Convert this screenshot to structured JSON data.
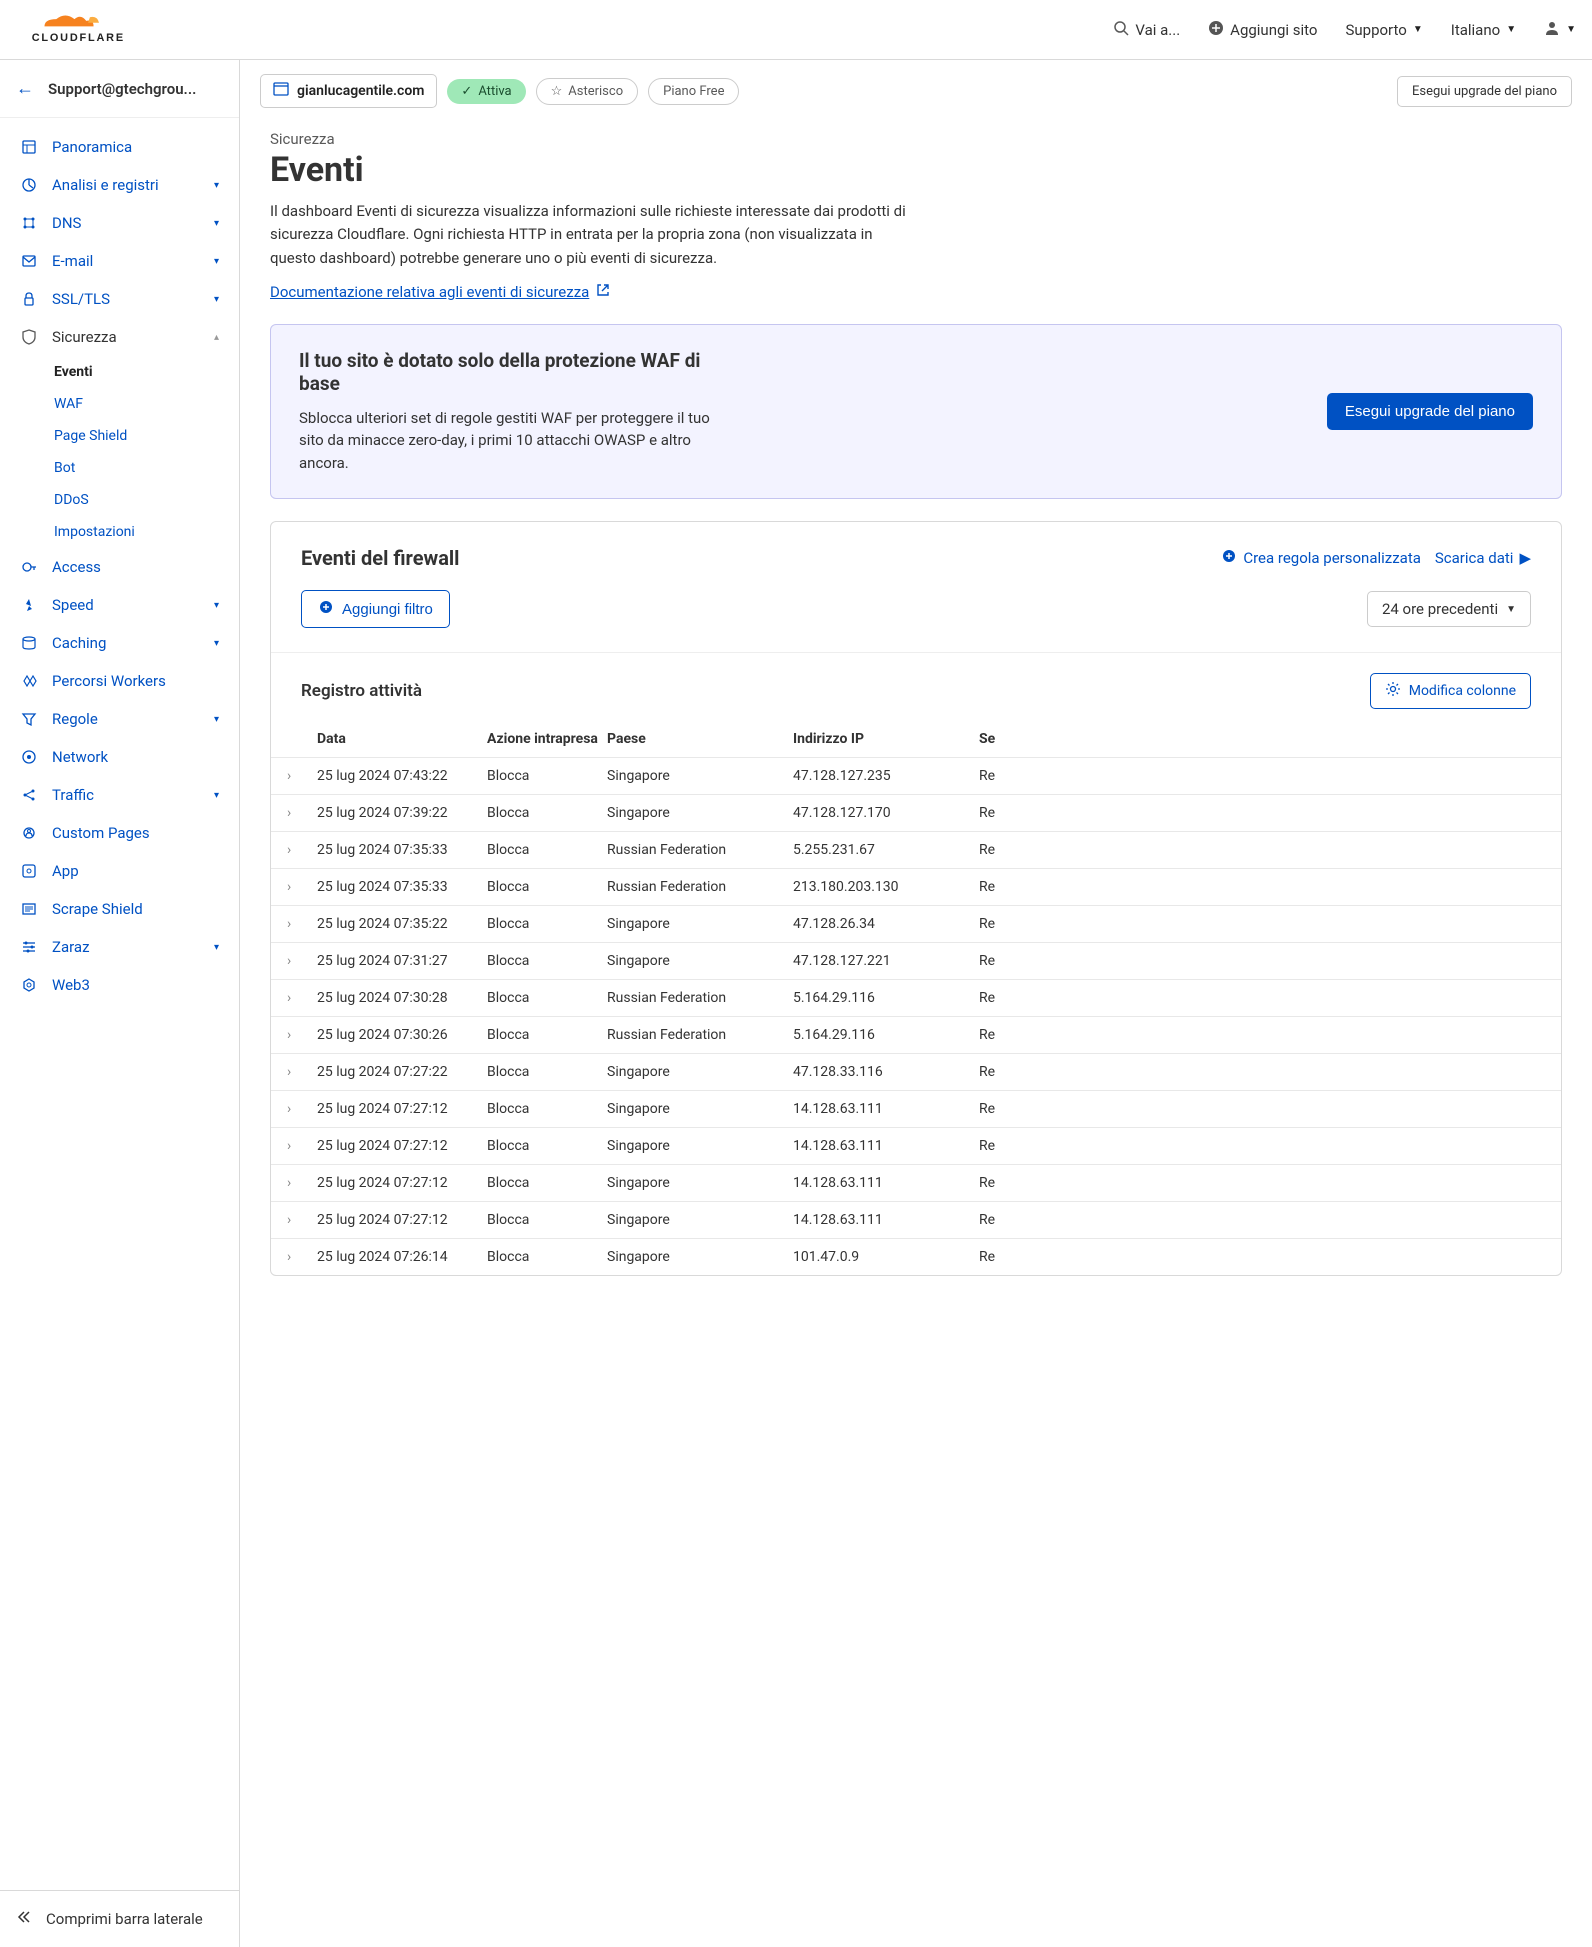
{
  "header": {
    "visit": "Vai a...",
    "add_site": "Aggiungi sito",
    "support": "Supporto",
    "language": "Italiano"
  },
  "account": {
    "email": "Support@gtechgrou..."
  },
  "sidebar": {
    "items": [
      {
        "label": "Panoramica",
        "key": "overview"
      },
      {
        "label": "Analisi e registri",
        "key": "analytics",
        "chev": true
      },
      {
        "label": "DNS",
        "key": "dns",
        "chev": true
      },
      {
        "label": "E-mail",
        "key": "email",
        "chev": true
      },
      {
        "label": "SSL/TLS",
        "key": "ssl",
        "chev": true
      },
      {
        "label": "Sicurezza",
        "key": "security",
        "chev": true,
        "expanded": true
      },
      {
        "label": "Access",
        "key": "access"
      },
      {
        "label": "Speed",
        "key": "speed",
        "chev": true
      },
      {
        "label": "Caching",
        "key": "caching",
        "chev": true
      },
      {
        "label": "Percorsi Workers",
        "key": "workers"
      },
      {
        "label": "Regole",
        "key": "rules",
        "chev": true
      },
      {
        "label": "Network",
        "key": "network"
      },
      {
        "label": "Traffic",
        "key": "traffic",
        "chev": true
      },
      {
        "label": "Custom Pages",
        "key": "cpages"
      },
      {
        "label": "App",
        "key": "app"
      },
      {
        "label": "Scrape Shield",
        "key": "scrape"
      },
      {
        "label": "Zaraz",
        "key": "zaraz",
        "chev": true
      },
      {
        "label": "Web3",
        "key": "web3"
      }
    ],
    "security_sub": [
      {
        "label": "Eventi",
        "active": true
      },
      {
        "label": "WAF"
      },
      {
        "label": "Page Shield"
      },
      {
        "label": "Bot"
      },
      {
        "label": "DDoS"
      },
      {
        "label": "Impostazioni"
      }
    ],
    "collapse": "Comprimi barra laterale"
  },
  "domain": {
    "name": "gianlucagentile.com",
    "active": "Attiva",
    "asterisk": "Asterisco",
    "plan": "Piano Free",
    "upgrade": "Esegui upgrade del piano"
  },
  "page": {
    "breadcrumb": "Sicurezza",
    "title": "Eventi",
    "description": "Il dashboard Eventi di sicurezza visualizza informazioni sulle richieste interessate dai prodotti di sicurezza Cloudflare. Ogni richiesta HTTP in entrata per la propria zona (non visualizzata in questo dashboard) potrebbe generare uno o più eventi di sicurezza.",
    "doc_link": "Documentazione relativa agli eventi di sicurezza"
  },
  "banner": {
    "title": "Il tuo sito è dotato solo della protezione WAF di base",
    "text": "Sblocca ulteriori set di regole gestiti WAF per proteggere il tuo sito da minacce zero-day, i primi 10 attacchi OWASP e altro ancora.",
    "button": "Esegui upgrade del piano"
  },
  "firewall": {
    "title": "Eventi del firewall",
    "create_rule": "Crea regola personalizzata",
    "download": "Scarica dati",
    "add_filter": "Aggiungi filtro",
    "time_range": "24 ore precedenti"
  },
  "log": {
    "title": "Registro attività",
    "modify_cols": "Modifica colonne",
    "columns": {
      "date": "Data",
      "action": "Azione intrapresa",
      "country": "Paese",
      "ip": "Indirizzo IP",
      "service": "Se"
    },
    "rows": [
      {
        "date": "25 lug 2024 07:43:22",
        "action": "Blocca",
        "country": "Singapore",
        "ip": "47.128.127.235",
        "service": "Re"
      },
      {
        "date": "25 lug 2024 07:39:22",
        "action": "Blocca",
        "country": "Singapore",
        "ip": "47.128.127.170",
        "service": "Re"
      },
      {
        "date": "25 lug 2024 07:35:33",
        "action": "Blocca",
        "country": "Russian Federation",
        "ip": "5.255.231.67",
        "service": "Re"
      },
      {
        "date": "25 lug 2024 07:35:33",
        "action": "Blocca",
        "country": "Russian Federation",
        "ip": "213.180.203.130",
        "service": "Re"
      },
      {
        "date": "25 lug 2024 07:35:22",
        "action": "Blocca",
        "country": "Singapore",
        "ip": "47.128.26.34",
        "service": "Re"
      },
      {
        "date": "25 lug 2024 07:31:27",
        "action": "Blocca",
        "country": "Singapore",
        "ip": "47.128.127.221",
        "service": "Re"
      },
      {
        "date": "25 lug 2024 07:30:28",
        "action": "Blocca",
        "country": "Russian Federation",
        "ip": "5.164.29.116",
        "service": "Re"
      },
      {
        "date": "25 lug 2024 07:30:26",
        "action": "Blocca",
        "country": "Russian Federation",
        "ip": "5.164.29.116",
        "service": "Re"
      },
      {
        "date": "25 lug 2024 07:27:22",
        "action": "Blocca",
        "country": "Singapore",
        "ip": "47.128.33.116",
        "service": "Re"
      },
      {
        "date": "25 lug 2024 07:27:12",
        "action": "Blocca",
        "country": "Singapore",
        "ip": "14.128.63.111",
        "service": "Re"
      },
      {
        "date": "25 lug 2024 07:27:12",
        "action": "Blocca",
        "country": "Singapore",
        "ip": "14.128.63.111",
        "service": "Re"
      },
      {
        "date": "25 lug 2024 07:27:12",
        "action": "Blocca",
        "country": "Singapore",
        "ip": "14.128.63.111",
        "service": "Re"
      },
      {
        "date": "25 lug 2024 07:27:12",
        "action": "Blocca",
        "country": "Singapore",
        "ip": "14.128.63.111",
        "service": "Re"
      },
      {
        "date": "25 lug 2024 07:26:14",
        "action": "Blocca",
        "country": "Singapore",
        "ip": "101.47.0.9",
        "service": "Re"
      }
    ]
  }
}
